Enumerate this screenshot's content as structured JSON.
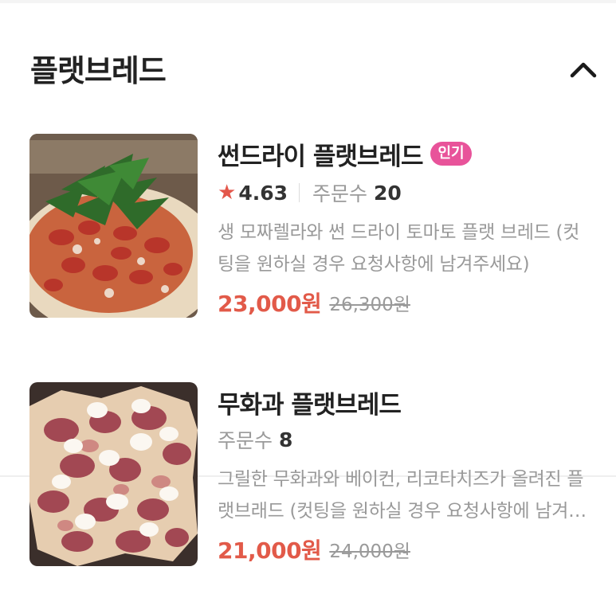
{
  "section": {
    "title": "플랫브레드",
    "collapse_icon": "chevron-up-icon"
  },
  "items": [
    {
      "name": "썬드라이 플랫브레드",
      "badge": "인기",
      "rating_icon": "star-icon",
      "rating": "4.63",
      "order_label": "주문수",
      "order_count": "20",
      "description": "생 모짜렐라와 썬 드라이 토마토 플랫 브레드 (컷팅을 원하실 경우 요청사항에 남겨주세요)",
      "price": "23,000원",
      "original_price": "26,300원",
      "colors": {
        "price": "#e25a49",
        "badge": "#e8539a",
        "star": "#e3574b"
      }
    },
    {
      "name": "무화과 플랫브레드",
      "order_label": "주문수",
      "order_count": "8",
      "description": "그릴한 무화과와 베이컨, 리코타치즈가 올려진 플랫브래드 (컷팅을 원하실 경우 요청사항에 남겨주세요)",
      "price": "21,000원",
      "original_price": "24,000원"
    }
  ]
}
